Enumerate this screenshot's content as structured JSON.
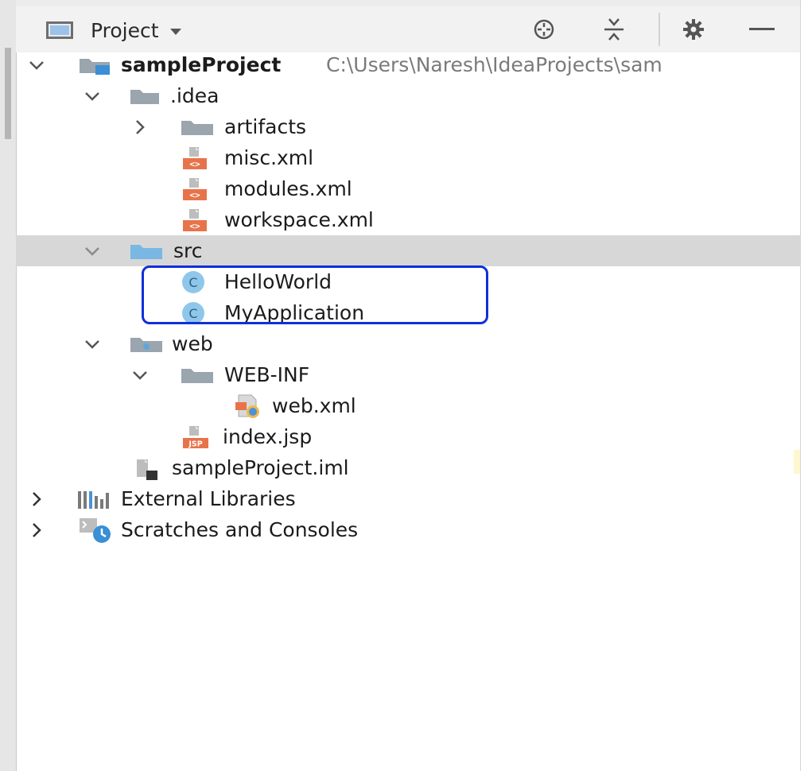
{
  "toolbar": {
    "view_label": "Project",
    "icons": [
      "panel-icon",
      "locate-icon",
      "collapse-all-icon",
      "gear-icon",
      "minimize-icon"
    ]
  },
  "tree": {
    "root": {
      "label": "sampleProject",
      "path": "C:\\Users\\Naresh\\IdeaProjects\\sam",
      "expanded": true
    },
    "idea": {
      "label": ".idea",
      "expanded": true
    },
    "artifacts": {
      "label": "artifacts",
      "expanded": false
    },
    "misc": {
      "label": "misc.xml",
      "icon_text": "<>"
    },
    "modules": {
      "label": "modules.xml",
      "icon_text": "<>"
    },
    "workspace": {
      "label": "workspace.xml",
      "icon_text": "<>"
    },
    "src": {
      "label": "src",
      "expanded": true,
      "selected": true
    },
    "helloworld": {
      "label": "HelloWorld",
      "icon_text": "C"
    },
    "myapplication": {
      "label": "MyApplication",
      "icon_text": "C"
    },
    "web": {
      "label": "web",
      "expanded": true
    },
    "webinf": {
      "label": "WEB-INF",
      "expanded": true
    },
    "webxml": {
      "label": "web.xml"
    },
    "indexjsp": {
      "label": "index.jsp",
      "icon_text": "JSP"
    },
    "iml": {
      "label": "sampleProject.iml"
    },
    "extlibs": {
      "label": "External Libraries",
      "expanded": false
    },
    "scratches": {
      "label": "Scratches and Consoles",
      "expanded": false
    }
  },
  "colors": {
    "selection": "#d7d7d7",
    "annotation": "#1030d8",
    "folder": "#9aa5ae",
    "source_folder": "#7ab8e4",
    "xml_badge": "#e8734a",
    "class_icon": "#8fc7ea"
  }
}
